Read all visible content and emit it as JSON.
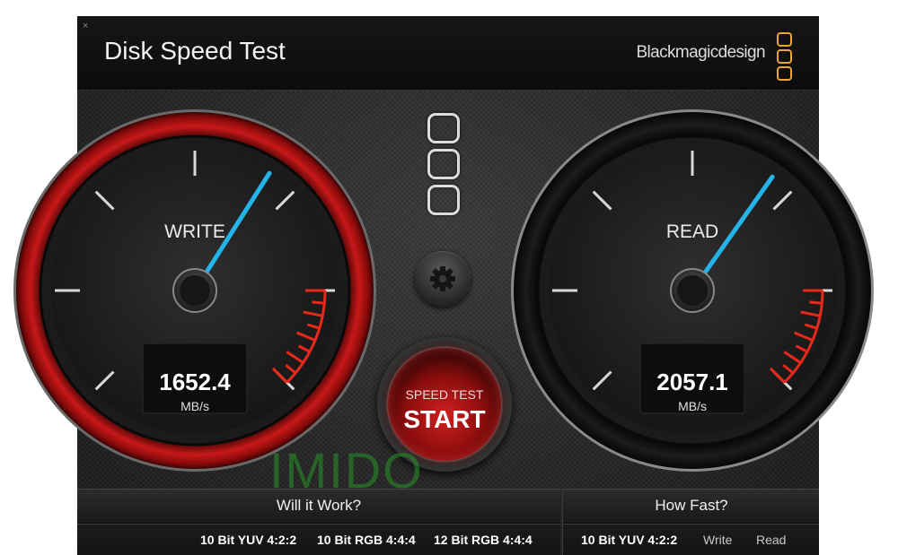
{
  "window": {
    "title": "Disk Speed Test",
    "brand": "Blackmagicdesign",
    "close_glyph": "×"
  },
  "colors": {
    "accent": "#e8a53a",
    "needle": "#25b4ea",
    "redline": "#e8281a",
    "write_ring": "#c01515"
  },
  "gauges": {
    "write": {
      "label": "WRITE",
      "value": "1652.4",
      "unit": "MB/s",
      "needle_fraction": 0.62
    },
    "read": {
      "label": "READ",
      "value": "2057.1",
      "unit": "MB/s",
      "needle_fraction": 0.63
    }
  },
  "start_button": {
    "caption": "SPEED TEST",
    "label": "START"
  },
  "watermark": "IMIDO",
  "will_it_work": {
    "title": "Will it Work?",
    "formats": [
      "10 Bit YUV 4:2:2",
      "10 Bit RGB 4:4:4",
      "12 Bit RGB 4:4:4"
    ]
  },
  "how_fast": {
    "title": "How Fast?",
    "format": "10 Bit YUV 4:2:2",
    "col_write": "Write",
    "col_read": "Read"
  },
  "icons": {
    "settings": "gear-icon",
    "logo": "blackmagic-logo-icon",
    "close": "close-icon"
  }
}
